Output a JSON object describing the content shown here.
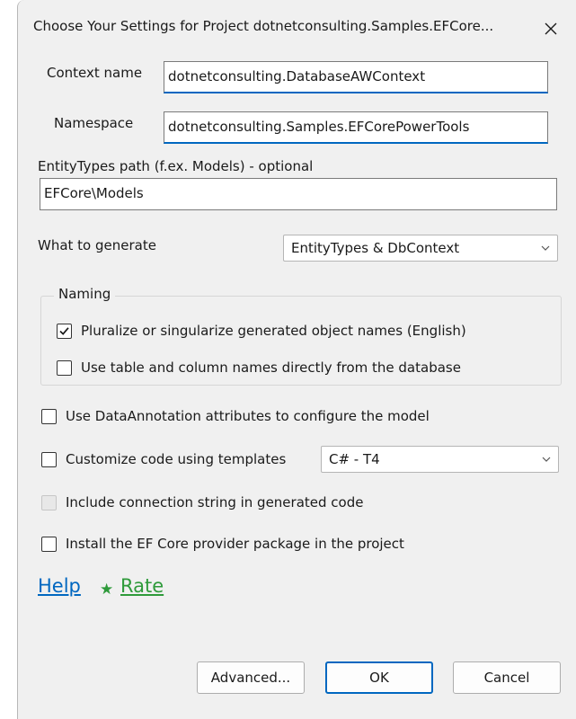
{
  "window": {
    "title": "Choose Your Settings for Project dotnetconsulting.Samples.EFCore...",
    "close_icon": "close-icon"
  },
  "context_name": {
    "label": "Context name",
    "value": "dotnetconsulting.DatabaseAWContext"
  },
  "namespace": {
    "label": "Namespace",
    "value": "dotnetconsulting.Samples.EFCorePowerTools"
  },
  "entity_path": {
    "label": "EntityTypes path (f.ex. Models) - optional",
    "value": "EFCore\\Models"
  },
  "generate": {
    "label": "What to generate",
    "selected": "EntityTypes & DbContext"
  },
  "naming": {
    "legend": "Naming",
    "pluralize": {
      "label": "Pluralize or singularize generated object names (English)",
      "checked": true
    },
    "use_db_names": {
      "label": "Use table and column names directly from the database",
      "checked": false
    }
  },
  "options": {
    "data_annotations": {
      "label": "Use DataAnnotation attributes to configure the model",
      "checked": false
    },
    "templates": {
      "label": "Customize code using templates",
      "checked": false,
      "selected": "C# - T4"
    },
    "connection_string": {
      "label": "Include connection string in generated code",
      "checked": false,
      "disabled": true
    },
    "install_provider": {
      "label": "Install the EF Core provider package in the project",
      "checked": false
    }
  },
  "links": {
    "help": "Help",
    "rate": "Rate",
    "help_color": "#0067c0",
    "rate_color": "#2e9a3a"
  },
  "buttons": {
    "advanced": "Advanced...",
    "ok": "OK",
    "cancel": "Cancel"
  },
  "colors": {
    "accent": "#0067c0",
    "dialog_bg": "#f0f0f0"
  }
}
